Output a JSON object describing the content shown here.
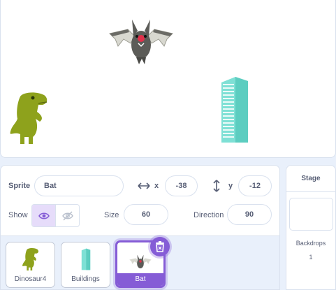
{
  "stage": {
    "sprites": [
      {
        "name": "bat-sprite-icon"
      },
      {
        "name": "dinosaur-sprite-icon"
      },
      {
        "name": "buildings-sprite-icon"
      }
    ]
  },
  "sprite_info": {
    "sprite_label": "Sprite",
    "sprite_name": "Bat",
    "x_label": "x",
    "x_value": "-38",
    "y_label": "y",
    "y_value": "-12",
    "show_label": "Show",
    "size_label": "Size",
    "size_value": "60",
    "direction_label": "Direction",
    "direction_value": "90"
  },
  "sprite_list": {
    "items": [
      {
        "label": "Dinosaur4"
      },
      {
        "label": "Buildings"
      },
      {
        "label": "Bat"
      }
    ],
    "selected": "Bat"
  },
  "stage_panel": {
    "title": "Stage",
    "backdrops_label": "Backdrops",
    "backdrops_count": "1"
  },
  "colors": {
    "accent": "#855cd6",
    "background": "#e9f0fb",
    "text": "#575e75"
  }
}
